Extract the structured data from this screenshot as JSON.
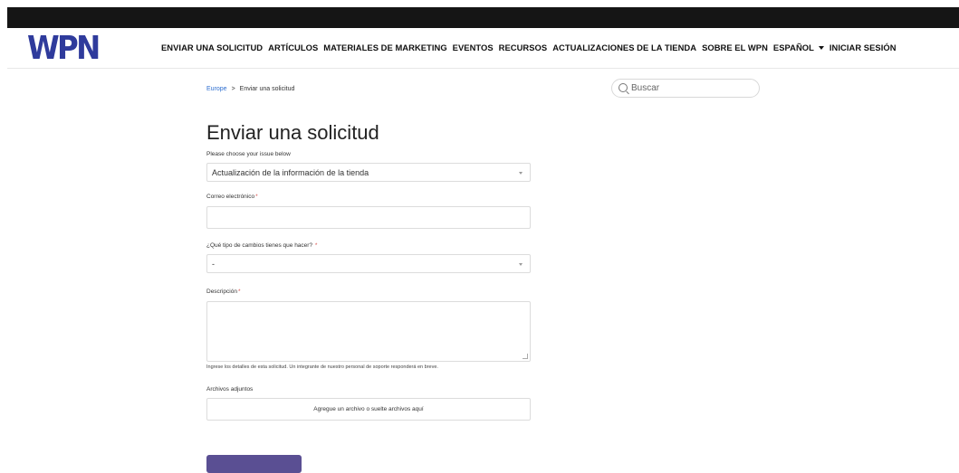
{
  "header": {
    "logo_text": "WPN",
    "nav": [
      {
        "label": "ENVIAR UNA SOLICITUD"
      },
      {
        "label": "ARTÍCULOS"
      },
      {
        "label": "MATERIALES DE MARKETING"
      },
      {
        "label": "EVENTOS"
      },
      {
        "label": "RECURSOS"
      },
      {
        "label": "ACTUALIZACIONES DE LA TIENDA"
      },
      {
        "label": "SOBRE EL WPN"
      },
      {
        "label": "ESPAÑOL"
      },
      {
        "label": "INICIAR SESIÓN"
      }
    ]
  },
  "breadcrumb": {
    "root": "Europe",
    "separator": ">",
    "current": "Enviar una solicitud"
  },
  "search": {
    "placeholder": "Buscar"
  },
  "form": {
    "title": "Enviar una solicitud",
    "issue_label": "Please choose your issue below",
    "issue_value": "Actualización de la información de la tienda",
    "email_label": "Correo electrónico",
    "email_value": "",
    "change_type_label": "¿Qué tipo de cambios tienes que hacer?",
    "change_type_value": "-",
    "description_label": "Descripción",
    "description_value": "",
    "description_help": "Ingrese los detalles de esta solicitud. Un integrante de nuestro personal de soporte responderá en breve.",
    "attachments_label": "Archivos adjuntos",
    "attachments_prompt": "Agregue un archivo o suelte archivos aquí",
    "required_mark": "*"
  },
  "colors": {
    "brand": "#2f3b9c",
    "link": "#2f6fd0",
    "required": "#d9534f",
    "button": "#5a4f93"
  }
}
